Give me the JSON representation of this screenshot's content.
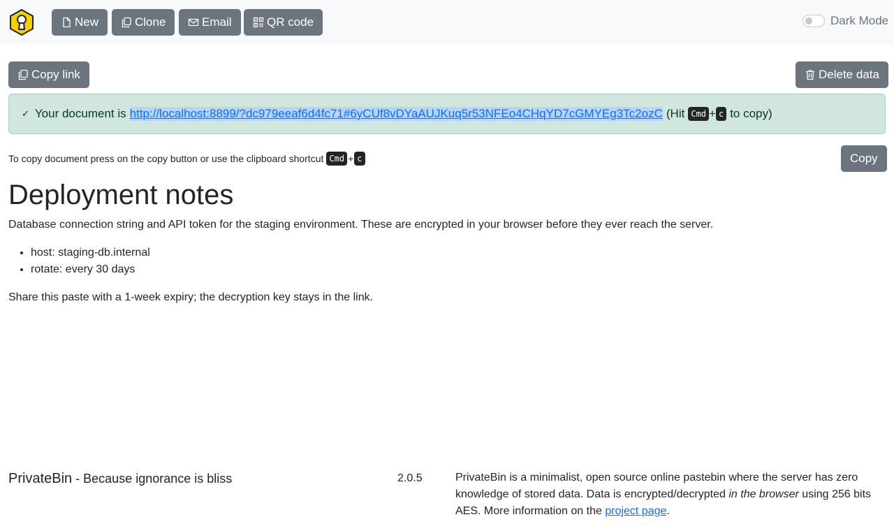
{
  "toolbar": {
    "new_label": "New",
    "clone_label": "Clone",
    "email_label": "Email",
    "qr_label": "QR code",
    "dark_mode_label": "Dark Mode",
    "dark_mode_on": false
  },
  "actions": {
    "copy_link_label": "Copy link",
    "delete_label": "Delete data",
    "copy_label": "Copy"
  },
  "alert": {
    "prefix": "Your document is",
    "url": "http://localhost:8899/?dc979eeaf6d4fc71#6yCUf8vDYaAUJKuq5r53NFEo4CHqYD7cGMYEg3Tc2ozC",
    "hint_open": "(Hit",
    "key_mod": "Cmd",
    "plus": "+",
    "key_c": "c",
    "hint_close": "to copy)"
  },
  "copy_hint": {
    "text": "To copy document press on the copy button or use the clipboard shortcut",
    "key_mod": "Cmd",
    "plus": "+",
    "key_c": "c"
  },
  "document": {
    "title": "Deployment notes",
    "intro": "Database connection string and API token for the staging environment. These are encrypted in your browser before they ever reach the server.",
    "items": [
      "host: staging-db.internal",
      "rotate: every 30 days"
    ],
    "outro": "Share this paste with a 1-week expiry; the decryption key stays in the link."
  },
  "footer": {
    "brand": "PrivateBin",
    "tagline": " - Because ignorance is bliss",
    "version": "2.0.5",
    "about_part1": "PrivateBin is a minimalist, open source online pastebin where the server has zero knowledge of stored data. Data is encrypted/decrypted ",
    "about_em": "in the browser",
    "about_part2": " using 256 bits AES. More information on the ",
    "about_link": "project page",
    "about_end": "."
  },
  "colors": {
    "button_bg": "#6c757d",
    "navbar_bg": "#f8f9fa",
    "alert_bg": "#d1e7dd",
    "link": "#0d6efd",
    "logo_fill": "#f5d000"
  },
  "icons": [
    "logo-icon",
    "file-icon",
    "clone-icon",
    "email-icon",
    "qr-icon",
    "copy-icon",
    "trash-icon",
    "check-icon"
  ]
}
